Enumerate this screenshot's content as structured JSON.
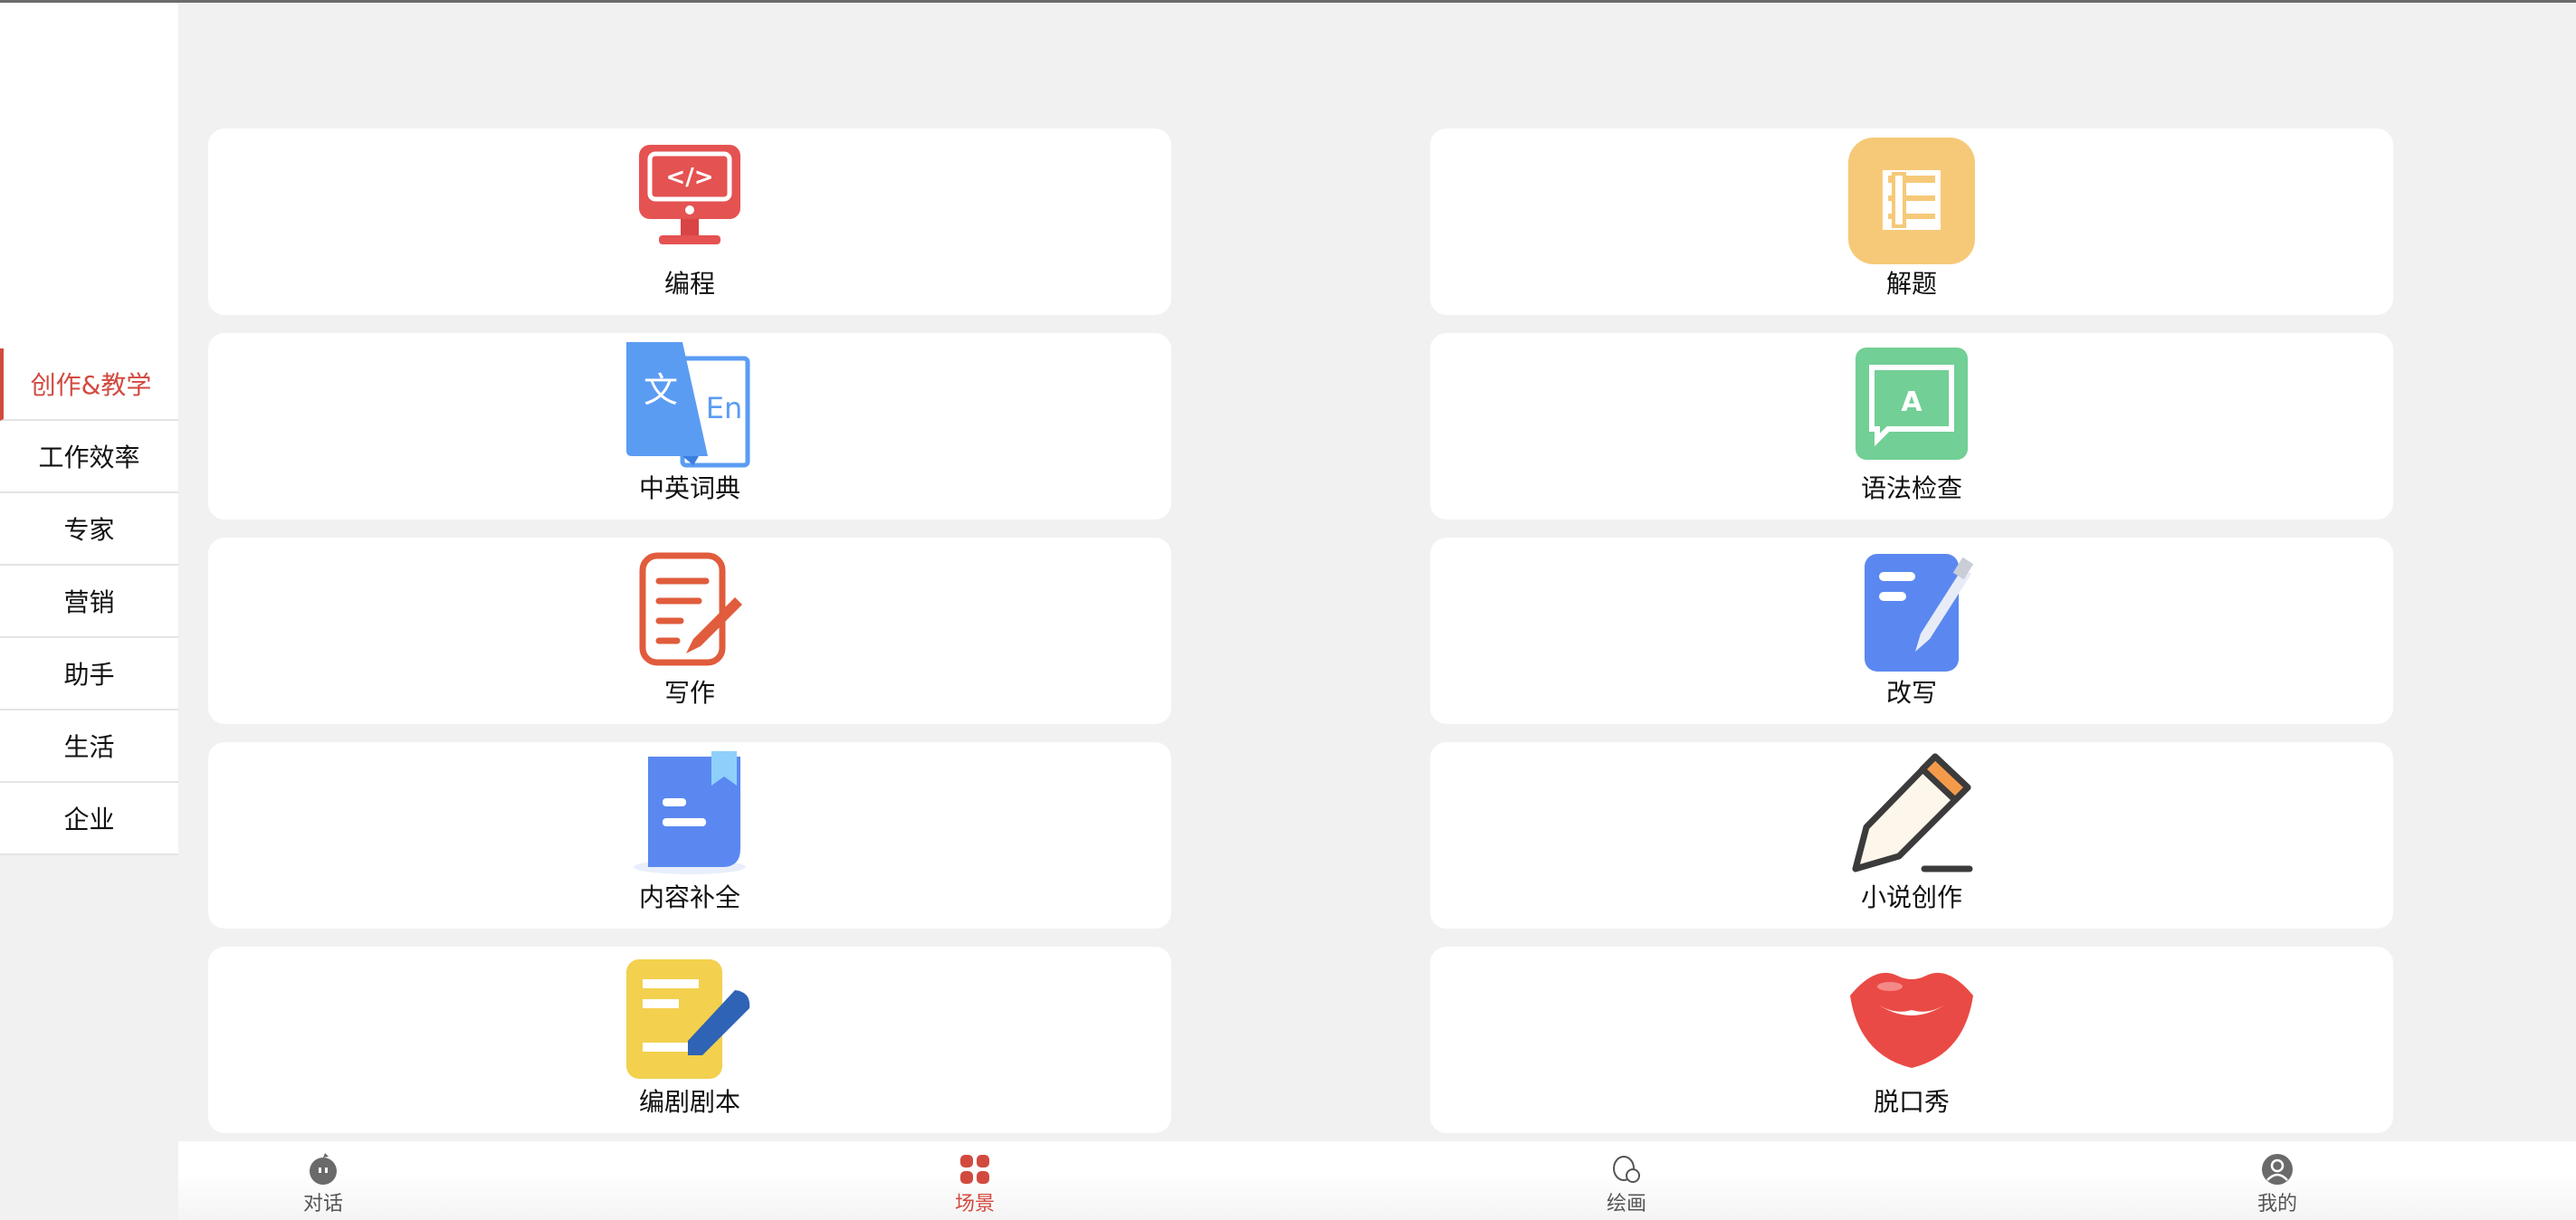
{
  "sidebar": {
    "items": [
      {
        "label": "创作&教学",
        "active": true
      },
      {
        "label": "工作效率"
      },
      {
        "label": "专家"
      },
      {
        "label": "营销"
      },
      {
        "label": "助手"
      },
      {
        "label": "生活"
      },
      {
        "label": "企业"
      }
    ]
  },
  "cards": [
    {
      "label": "编程",
      "icon": "monitor-code-icon"
    },
    {
      "label": "解题",
      "icon": "book-icon"
    },
    {
      "label": "中英词典",
      "icon": "translate-icon"
    },
    {
      "label": "语法检查",
      "icon": "grammar-board-icon"
    },
    {
      "label": "写作",
      "icon": "writing-icon"
    },
    {
      "label": "改写",
      "icon": "rewrite-icon"
    },
    {
      "label": "内容补全",
      "icon": "document-bookmark-icon"
    },
    {
      "label": "小说创作",
      "icon": "pencil-icon"
    },
    {
      "label": "编剧剧本",
      "icon": "script-icon"
    },
    {
      "label": "脱口秀",
      "icon": "lips-icon"
    }
  ],
  "bottom_nav": [
    {
      "label": "对话",
      "icon": "chat-bot-icon"
    },
    {
      "label": "场景",
      "icon": "grid-icon",
      "active": true
    },
    {
      "label": "绘画",
      "icon": "painting-icon"
    },
    {
      "label": "我的",
      "icon": "user-icon"
    }
  ],
  "colors": {
    "accent": "#d24a3f"
  }
}
